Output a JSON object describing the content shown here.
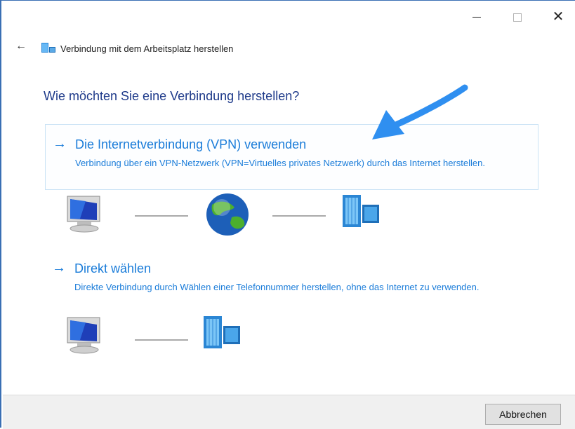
{
  "window": {
    "title": "Verbindung mit dem Arbeitsplatz herstellen",
    "minimize_label": "",
    "maximize_label": "",
    "close_label": "✕",
    "back_label": "←"
  },
  "heading": "Wie möchten Sie eine Verbindung herstellen?",
  "options": [
    {
      "arrow": "→",
      "title": "Die Internetverbindung (VPN) verwenden",
      "description": "Verbindung über ein VPN-Netzwerk (VPN=Virtuelles privates Netzwerk) durch das Internet herstellen."
    },
    {
      "arrow": "→",
      "title": "Direkt wählen",
      "description": "Direkte Verbindung durch Wählen einer Telefonnummer herstellen, ohne das Internet zu verwenden."
    }
  ],
  "footer": {
    "cancel_label": "Abbrechen"
  },
  "colors": {
    "link": "#1a7cd9",
    "heading": "#1e3a8a",
    "callout_arrow": "#2f8ff0"
  },
  "icons": {
    "computer": "computer-monitor-icon",
    "globe": "globe-icon",
    "server": "server-icon",
    "network": "network-connection-icon"
  }
}
